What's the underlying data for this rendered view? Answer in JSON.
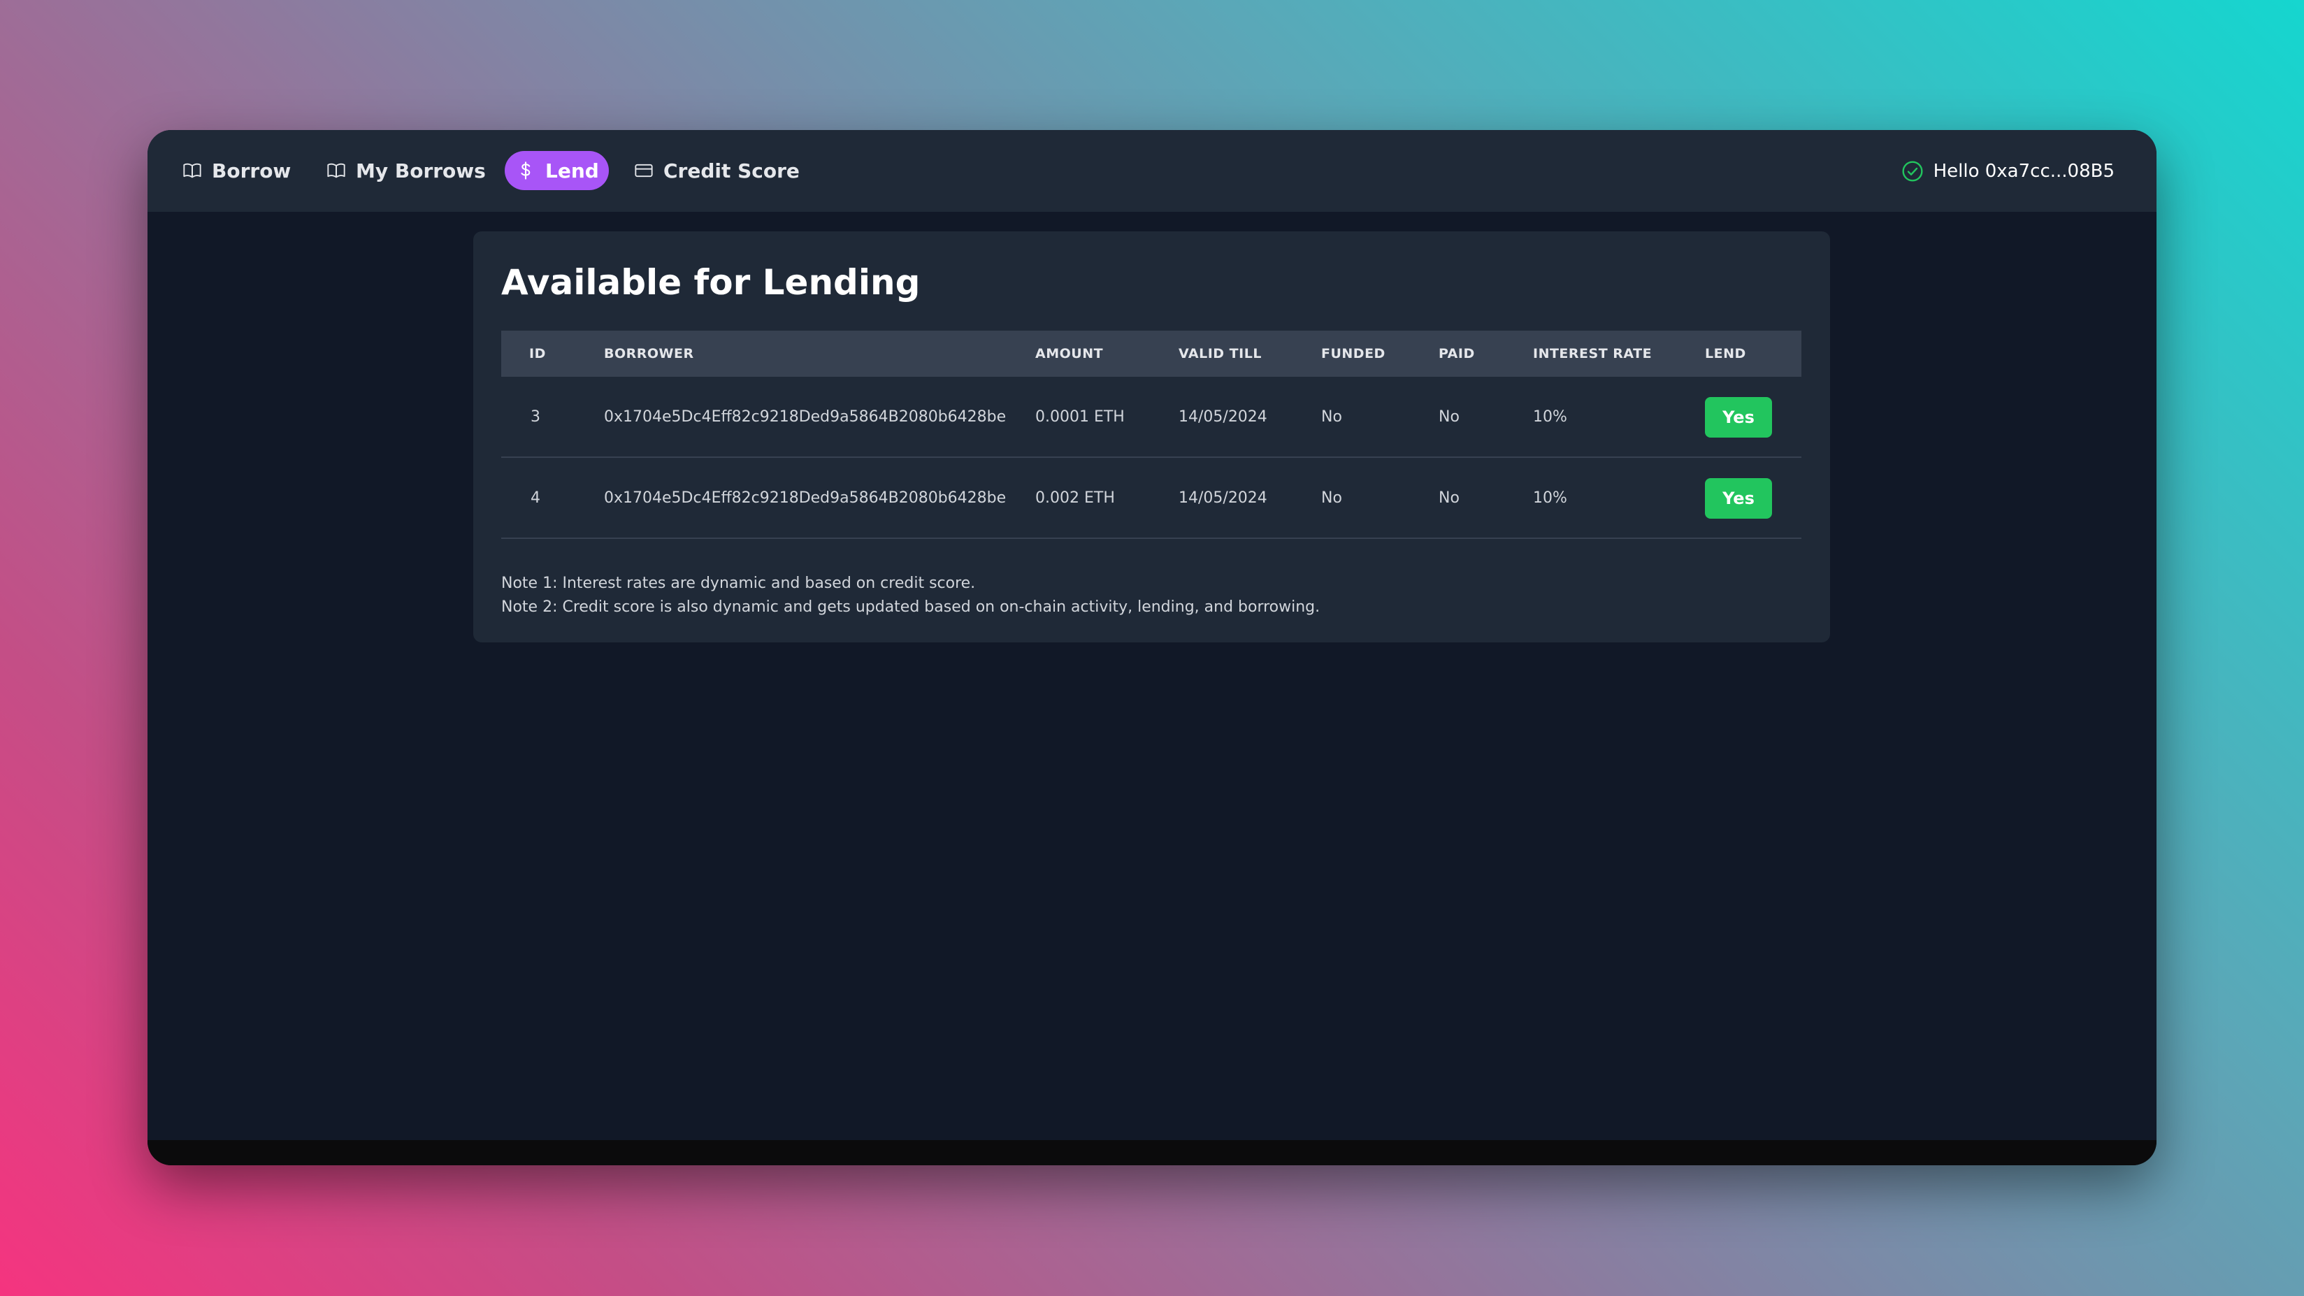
{
  "nav": {
    "items": [
      {
        "label": "Borrow",
        "icon": "book-open-icon"
      },
      {
        "label": "My Borrows",
        "icon": "book-open-icon"
      },
      {
        "label": "Lend",
        "icon": "dollar-icon",
        "active": true
      },
      {
        "label": "Credit Score",
        "icon": "credit-card-icon"
      }
    ],
    "user_greeting": "Hello 0xa7cc...08B5"
  },
  "colors": {
    "active_tab": "#a855f7",
    "lend_button": "#22c55e",
    "check_icon": "#22c55e"
  },
  "main": {
    "title": "Available for Lending",
    "table": {
      "headers": [
        "ID",
        "BORROWER",
        "AMOUNT",
        "VALID TILL",
        "FUNDED",
        "PAID",
        "INTEREST RATE",
        "LEND"
      ],
      "rows": [
        {
          "id": "3",
          "borrower": "0x1704e5Dc4Eff82c9218Ded9a5864B2080b6428be",
          "amount": "0.0001 ETH",
          "valid_till": "14/05/2024",
          "funded": "No",
          "paid": "No",
          "interest_rate": "10%",
          "lend": "Yes"
        },
        {
          "id": "4",
          "borrower": "0x1704e5Dc4Eff82c9218Ded9a5864B2080b6428be",
          "amount": "0.002 ETH",
          "valid_till": "14/05/2024",
          "funded": "No",
          "paid": "No",
          "interest_rate": "10%",
          "lend": "Yes"
        }
      ]
    },
    "notes": [
      "Note 1: Interest rates are dynamic and based on credit score.",
      "Note 2: Credit score is also dynamic and gets updated based on on-chain activity, lending, and borrowing."
    ]
  }
}
